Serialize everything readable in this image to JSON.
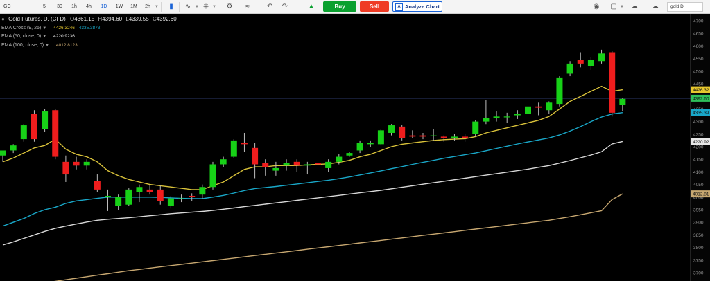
{
  "toolbar": {
    "symbol": "GC",
    "timeframes": [
      "5",
      "30",
      "1h",
      "4h",
      "1D",
      "1W",
      "1M",
      "2h"
    ],
    "active_timeframe": "1D",
    "buy_label": "Buy",
    "sell_label": "Sell",
    "analyze_label": "Analyze Chart",
    "search_value": "gold D"
  },
  "legend": {
    "title": "Gold Futures, D, (CFD)",
    "ohlc": [
      {
        "k": "O",
        "v": "4361.15"
      },
      {
        "k": "H",
        "v": "4394.60"
      },
      {
        "k": "L",
        "v": "4339.55"
      },
      {
        "k": "C",
        "v": "4392.60"
      }
    ],
    "indicators": [
      {
        "label": "EMA Cross (9, 26)",
        "values": [
          "4426.3246",
          "4335.3873"
        ],
        "colors": [
          "#d9c23a",
          "#19a8c9"
        ]
      },
      {
        "label": "EMA (50, close, 0)",
        "values": [
          "4220.9236"
        ],
        "colors": [
          "#d9d9d9"
        ]
      },
      {
        "label": "EMA (100, close, 0)",
        "values": [
          "4012.8123"
        ],
        "colors": [
          "#c8a871"
        ]
      }
    ]
  },
  "chart_data": {
    "type": "candlestick",
    "title": "Gold Futures, D, (CFD)",
    "ylim": [
      3700,
      4700
    ],
    "y_ticks": [
      4700,
      4650,
      4600,
      4550,
      4500,
      4450,
      4400,
      4350,
      4300,
      4250,
      4200,
      4150,
      4100,
      4050,
      4000,
      3950,
      3900,
      3850,
      3800,
      3750,
      3700
    ],
    "candles": [
      {
        "o": 4165,
        "h": 4180,
        "l": 4140,
        "c": 4185
      },
      {
        "o": 4185,
        "h": 4210,
        "l": 4175,
        "c": 4205
      },
      {
        "o": 4230,
        "h": 4290,
        "l": 4220,
        "c": 4285
      },
      {
        "o": 4330,
        "h": 4345,
        "l": 4220,
        "c": 4230
      },
      {
        "o": 4270,
        "h": 4350,
        "l": 4260,
        "c": 4340
      },
      {
        "o": 4345,
        "h": 4350,
        "l": 4150,
        "c": 4160
      },
      {
        "o": 4140,
        "h": 4165,
        "l": 4060,
        "c": 4090
      },
      {
        "o": 4140,
        "h": 4160,
        "l": 4110,
        "c": 4125
      },
      {
        "o": 4125,
        "h": 4150,
        "l": 4110,
        "c": 4140
      },
      {
        "o": 4065,
        "h": 4090,
        "l": 4020,
        "c": 4030
      },
      {
        "o": 4000,
        "h": 4030,
        "l": 3945,
        "c": 4005
      },
      {
        "o": 3965,
        "h": 4010,
        "l": 3950,
        "c": 4000
      },
      {
        "o": 3970,
        "h": 4035,
        "l": 3965,
        "c": 4030
      },
      {
        "o": 4020,
        "h": 4050,
        "l": 3980,
        "c": 4040
      },
      {
        "o": 4030,
        "h": 4050,
        "l": 4010,
        "c": 4020
      },
      {
        "o": 4030,
        "h": 4045,
        "l": 3970,
        "c": 3985
      },
      {
        "o": 3965,
        "h": 4005,
        "l": 3955,
        "c": 3995
      },
      {
        "o": 3995,
        "h": 4010,
        "l": 3980,
        "c": 3995
      },
      {
        "o": 4005,
        "h": 4015,
        "l": 3985,
        "c": 4000
      },
      {
        "o": 4010,
        "h": 4050,
        "l": 3995,
        "c": 4040
      },
      {
        "o": 4040,
        "h": 4140,
        "l": 4030,
        "c": 4130
      },
      {
        "o": 4130,
        "h": 4160,
        "l": 4120,
        "c": 4150
      },
      {
        "o": 4160,
        "h": 4230,
        "l": 4155,
        "c": 4225
      },
      {
        "o": 4215,
        "h": 4255,
        "l": 4180,
        "c": 4210
      },
      {
        "o": 4195,
        "h": 4215,
        "l": 4075,
        "c": 4130
      },
      {
        "o": 4135,
        "h": 4150,
        "l": 4085,
        "c": 4120
      },
      {
        "o": 4105,
        "h": 4140,
        "l": 4085,
        "c": 4115
      },
      {
        "o": 4125,
        "h": 4150,
        "l": 4105,
        "c": 4135
      },
      {
        "o": 4140,
        "h": 4150,
        "l": 4100,
        "c": 4125
      },
      {
        "o": 4125,
        "h": 4140,
        "l": 4090,
        "c": 4130
      },
      {
        "o": 4135,
        "h": 4145,
        "l": 4105,
        "c": 4130
      },
      {
        "o": 4115,
        "h": 4150,
        "l": 4100,
        "c": 4140
      },
      {
        "o": 4140,
        "h": 4170,
        "l": 4130,
        "c": 4160
      },
      {
        "o": 4165,
        "h": 4180,
        "l": 4160,
        "c": 4175
      },
      {
        "o": 4185,
        "h": 4225,
        "l": 4175,
        "c": 4215
      },
      {
        "o": 4210,
        "h": 4225,
        "l": 4200,
        "c": 4215
      },
      {
        "o": 4210,
        "h": 4270,
        "l": 4205,
        "c": 4265
      },
      {
        "o": 4255,
        "h": 4290,
        "l": 4245,
        "c": 4285
      },
      {
        "o": 4280,
        "h": 4285,
        "l": 4225,
        "c": 4235
      },
      {
        "o": 4245,
        "h": 4265,
        "l": 4235,
        "c": 4240
      },
      {
        "o": 4245,
        "h": 4255,
        "l": 4230,
        "c": 4240
      },
      {
        "o": 4245,
        "h": 4270,
        "l": 4225,
        "c": 4245
      },
      {
        "o": 4240,
        "h": 4245,
        "l": 4220,
        "c": 4235
      },
      {
        "o": 4235,
        "h": 4250,
        "l": 4225,
        "c": 4240
      },
      {
        "o": 4240,
        "h": 4250,
        "l": 4220,
        "c": 4235
      },
      {
        "o": 4250,
        "h": 4305,
        "l": 4240,
        "c": 4300
      },
      {
        "o": 4300,
        "h": 4385,
        "l": 4290,
        "c": 4315
      },
      {
        "o": 4315,
        "h": 4340,
        "l": 4300,
        "c": 4320
      },
      {
        "o": 4320,
        "h": 4335,
        "l": 4295,
        "c": 4320
      },
      {
        "o": 4325,
        "h": 4345,
        "l": 4310,
        "c": 4330
      },
      {
        "o": 4330,
        "h": 4365,
        "l": 4320,
        "c": 4360
      },
      {
        "o": 4360,
        "h": 4375,
        "l": 4325,
        "c": 4355
      },
      {
        "o": 4345,
        "h": 4380,
        "l": 4330,
        "c": 4375
      },
      {
        "o": 4370,
        "h": 4480,
        "l": 4360,
        "c": 4475
      },
      {
        "o": 4490,
        "h": 4540,
        "l": 4480,
        "c": 4530
      },
      {
        "o": 4545,
        "h": 4575,
        "l": 4515,
        "c": 4530
      },
      {
        "o": 4520,
        "h": 4555,
        "l": 4505,
        "c": 4545
      },
      {
        "o": 4540,
        "h": 4585,
        "l": 4530,
        "c": 4570
      },
      {
        "o": 4575,
        "h": 4580,
        "l": 4320,
        "c": 4335
      },
      {
        "o": 4365,
        "h": 4395,
        "l": 4340,
        "c": 4390
      }
    ],
    "series": [
      {
        "name": "EMA Cross (9, 26)",
        "color": "#d9c23a",
        "values": [
          4140,
          4155,
          4175,
          4195,
          4205,
          4230,
          4190,
          4170,
          4160,
          4140,
          4105,
          4085,
          4070,
          4060,
          4050,
          4045,
          4040,
          4035,
          4030,
          4030,
          4045,
          4060,
          4085,
          4110,
          4120,
          4120,
          4125,
          4125,
          4125,
          4128,
          4130,
          4132,
          4138,
          4146,
          4160,
          4170,
          4185,
          4200,
          4210,
          4215,
          4220,
          4225,
          4228,
          4230,
          4232,
          4240,
          4255,
          4265,
          4275,
          4285,
          4295,
          4305,
          4320,
          4350,
          4380,
          4400,
          4420,
          4440,
          4420,
          4426.32
        ]
      },
      {
        "name": "EMA Cross (9, 26)",
        "color": "#19a8c9",
        "values": [
          3885,
          3900,
          3915,
          3935,
          3950,
          3960,
          3975,
          3985,
          3990,
          3995,
          4000,
          4000,
          4000,
          4000,
          4000,
          3999,
          3997,
          3995,
          3994,
          3994,
          4000,
          4007,
          4016,
          4026,
          4034,
          4038,
          4042,
          4047,
          4052,
          4057,
          4062,
          4067,
          4073,
          4080,
          4088,
          4096,
          4104,
          4113,
          4121,
          4130,
          4138,
          4146,
          4154,
          4161,
          4168,
          4175,
          4184,
          4193,
          4202,
          4211,
          4219,
          4227,
          4235,
          4247,
          4262,
          4280,
          4300,
          4318,
          4330,
          4335.39
        ]
      },
      {
        "name": "EMA (50, close, 0)",
        "color": "#d9d9d9",
        "values": [
          3810,
          3822,
          3836,
          3850,
          3864,
          3876,
          3885,
          3893,
          3901,
          3908,
          3912,
          3915,
          3918,
          3922,
          3926,
          3930,
          3934,
          3937,
          3940,
          3943,
          3947,
          3952,
          3957,
          3962,
          3967,
          3972,
          3977,
          3982,
          3987,
          3992,
          3997,
          4002,
          4007,
          4012,
          4017,
          4022,
          4027,
          4033,
          4039,
          4045,
          4051,
          4057,
          4063,
          4069,
          4075,
          4081,
          4087,
          4093,
          4099,
          4105,
          4111,
          4118,
          4125,
          4135,
          4145,
          4156,
          4167,
          4180,
          4211,
          4220.92
        ]
      },
      {
        "name": "EMA (100, close, 0)",
        "color": "#c8a871",
        "values": [
          3630,
          3638,
          3645,
          3652,
          3659,
          3666,
          3672,
          3678,
          3684,
          3690,
          3696,
          3702,
          3708,
          3713,
          3718,
          3723,
          3728,
          3733,
          3738,
          3743,
          3748,
          3753,
          3758,
          3763,
          3768,
          3773,
          3778,
          3783,
          3788,
          3793,
          3798,
          3803,
          3808,
          3813,
          3818,
          3823,
          3828,
          3833,
          3838,
          3843,
          3848,
          3853,
          3858,
          3863,
          3868,
          3873,
          3878,
          3883,
          3888,
          3893,
          3898,
          3903,
          3908,
          3915,
          3922,
          3930,
          3938,
          3946,
          3990,
          4012.81
        ]
      }
    ],
    "price_labels": [
      {
        "value": "4426.32",
        "num": 4426.32,
        "color": "#e6c72e"
      },
      {
        "value": "4392.60",
        "num": 4392.6,
        "color": "#2fbf5a"
      },
      {
        "value": "4335.39",
        "num": 4335.39,
        "color": "#19a8c9"
      },
      {
        "value": "4220.92",
        "num": 4220.92,
        "color": "#e8e8e8"
      },
      {
        "value": "4012.81",
        "num": 4012.81,
        "color": "#c8a871"
      }
    ],
    "current_price": 4392.6,
    "up_color": "#17d117",
    "down_color": "#ef1d1d"
  }
}
